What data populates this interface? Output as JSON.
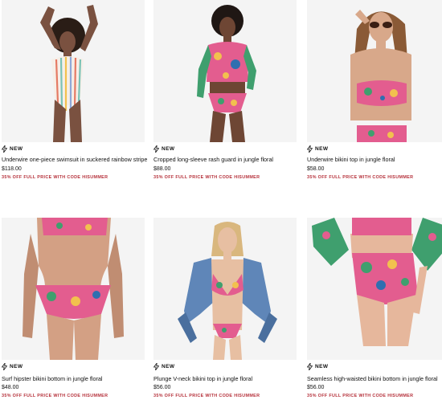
{
  "products": [
    {
      "badge": "NEW",
      "name": "Underwire one-piece swimsuit in suckered rainbow stripe",
      "price": "$118.00",
      "promo": "35% OFF FULL PRICE WITH CODE HISUMMER",
      "image": "model-striped-one-piece"
    },
    {
      "badge": "NEW",
      "name": "Cropped long-sleeve rash guard in jungle floral",
      "price": "$88.00",
      "promo": "35% OFF FULL PRICE WITH CODE HISUMMER",
      "image": "model-floral-rash-guard"
    },
    {
      "badge": "NEW",
      "name": "Underwire bikini top in jungle floral",
      "price": "$58.00",
      "promo": "35% OFF FULL PRICE WITH CODE HISUMMER",
      "image": "model-floral-bikini-top-sunglasses"
    },
    {
      "badge": "NEW",
      "name": "Surf hipster bikini bottom in jungle floral",
      "price": "$48.00",
      "promo": "35% OFF FULL PRICE WITH CODE HISUMMER",
      "image": "model-floral-hipster-bottom"
    },
    {
      "badge": "NEW",
      "name": "Plunge V-neck bikini top in jungle floral",
      "price": "$56.00",
      "promo": "35% OFF FULL PRICE WITH CODE HISUMMER",
      "image": "model-floral-bikini-denim-jacket"
    },
    {
      "badge": "NEW",
      "name": "Seamless high-waisted bikini bottom in jungle floral",
      "price": "$56.00",
      "promo": "35% OFF FULL PRICE WITH CODE HISUMMER",
      "image": "model-floral-high-waisted-bottom"
    }
  ],
  "colors": {
    "promo": "#b5303a",
    "photo_bg": "#f3f3f3",
    "skin": "#c89a7a"
  },
  "icons": {
    "badge": "lightning-bolt-icon"
  }
}
